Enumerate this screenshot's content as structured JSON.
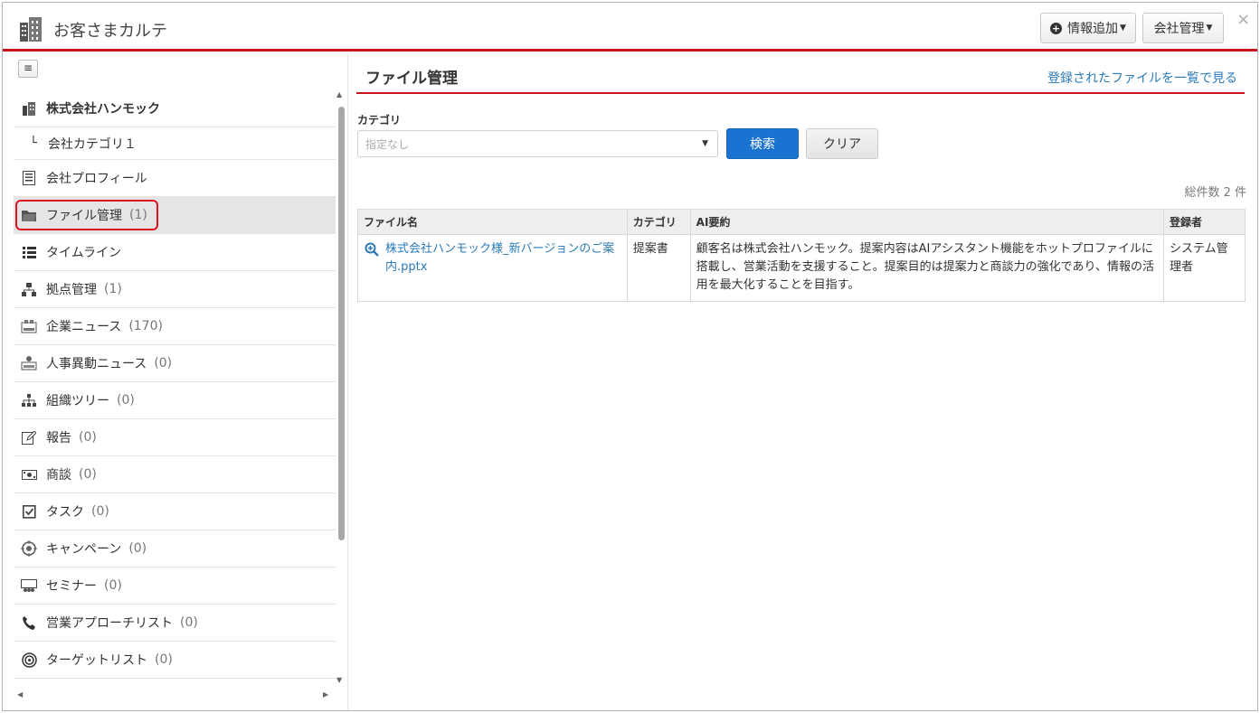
{
  "header": {
    "title": "お客さまカルテ",
    "add_info_label": "情報追加",
    "company_mgmt_label": "会社管理",
    "close_label": "×"
  },
  "sidebar": {
    "toggle_label": "≡",
    "company_name": "株式会社ハンモック",
    "company_category": "会社カテゴリ１",
    "items": [
      {
        "label": "会社プロフィール",
        "count": "",
        "icon": "profile-icon"
      },
      {
        "label": "ファイル管理",
        "count": "(1)",
        "icon": "folder-icon"
      },
      {
        "label": "タイムライン",
        "count": "",
        "icon": "list-icon"
      },
      {
        "label": "拠点管理",
        "count": "(1)",
        "icon": "sitemap-icon"
      },
      {
        "label": "企業ニュース",
        "count": "(170)",
        "icon": "news-icon"
      },
      {
        "label": "人事異動ニュース",
        "count": "(0)",
        "icon": "news-person-icon"
      },
      {
        "label": "組織ツリー",
        "count": "(0)",
        "icon": "org-tree-icon"
      },
      {
        "label": "報告",
        "count": "(0)",
        "icon": "report-icon"
      },
      {
        "label": "商談",
        "count": "(0)",
        "icon": "money-icon"
      },
      {
        "label": "タスク",
        "count": "(0)",
        "icon": "task-icon"
      },
      {
        "label": "キャンペーン",
        "count": "(0)",
        "icon": "campaign-icon"
      },
      {
        "label": "セミナー",
        "count": "(0)",
        "icon": "seminar-icon"
      },
      {
        "label": "営業アプローチリスト",
        "count": "(0)",
        "icon": "phone-icon"
      },
      {
        "label": "ターゲットリスト",
        "count": "(0)",
        "icon": "target-icon"
      }
    ],
    "active_item": "ファイル管理"
  },
  "main": {
    "title": "ファイル管理",
    "list_link": "登録されたファイルを一覧で見る",
    "category_label": "カテゴリ",
    "category_placeholder": "指定なし",
    "search_label": "検索",
    "clear_label": "クリア",
    "total": "総件数 2 件",
    "table": {
      "headers": [
        "ファイル名",
        "カテゴリ",
        "AI要約",
        "登録者"
      ],
      "rows": [
        {
          "file_name": "株式会社ハンモック様_新バージョンのご案内.pptx",
          "category": "提案書",
          "summary": "顧客名は株式会社ハンモック。提案内容はAIアシスタント機能をホットプロファイルに搭載し、営業活動を支援すること。提案目的は提案力と商談力の強化であり、情報の活用を最大化することを目指す。",
          "registrant": "システム管理者"
        }
      ]
    }
  },
  "colors": {
    "accent_red": "#c8161d",
    "link_blue": "#2a7ab8",
    "primary_button": "#1a73d1"
  }
}
